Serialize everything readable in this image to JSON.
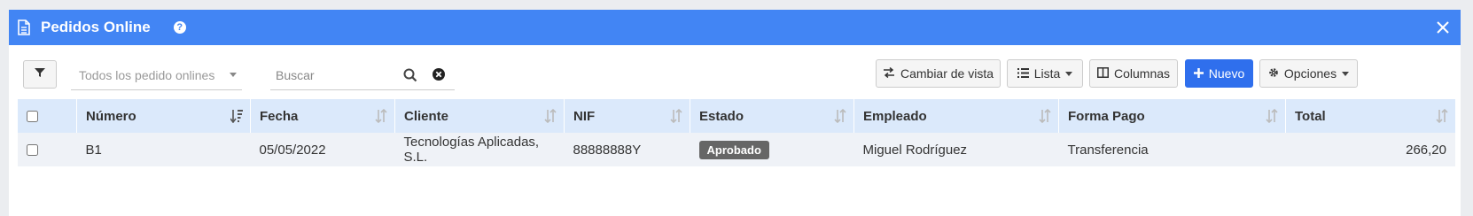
{
  "window": {
    "title": "Pedidos Online"
  },
  "colors": {
    "titlebar": "#4285f4",
    "primary": "#2f6fed",
    "header_row": "#dbe9fb",
    "badge": "#666666"
  },
  "filter": {
    "select_value": "Todos los pedido onlines"
  },
  "search": {
    "placeholder": "Buscar"
  },
  "toolbar": {
    "change_view": "Cambiar de vista",
    "list": "Lista",
    "columns": "Columnas",
    "new": "Nuevo",
    "options": "Opciones"
  },
  "table": {
    "headers": [
      "Número",
      "Fecha",
      "Cliente",
      "NIF",
      "Estado",
      "Empleado",
      "Forma Pago",
      "Total"
    ],
    "rows": [
      {
        "numero": "B1",
        "fecha": "05/05/2022",
        "cliente": "Tecnologías Aplicadas, S.L.",
        "nif": "88888888Y",
        "estado": "Aprobado",
        "empleado": "Miguel Rodríguez",
        "forma_pago": "Transferencia",
        "total": "266,20"
      }
    ]
  }
}
